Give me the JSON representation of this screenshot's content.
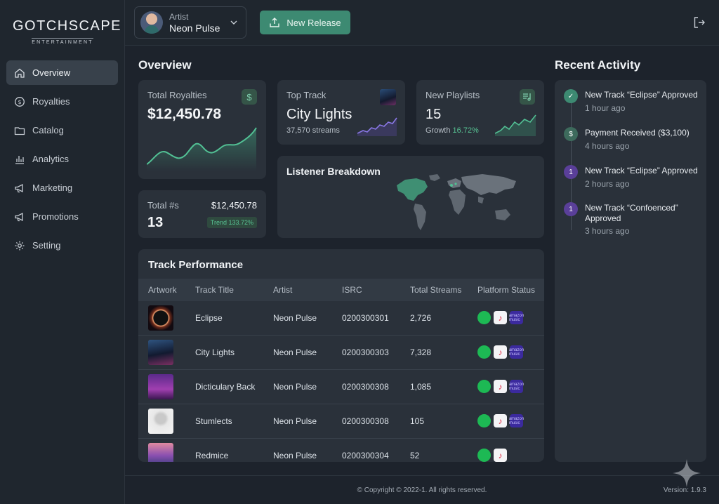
{
  "brand": {
    "name": "GOTCHSCAPE",
    "sub": "ENTERTAINMENT"
  },
  "sidebar": {
    "items": [
      {
        "label": "Overview",
        "icon": "home-icon",
        "active": true
      },
      {
        "label": "Royalties",
        "icon": "dollar-circle-icon"
      },
      {
        "label": "Catalog",
        "icon": "folder-icon"
      },
      {
        "label": "Analytics",
        "icon": "bar-chart-icon"
      },
      {
        "label": "Marketing",
        "icon": "megaphone-icon"
      },
      {
        "label": "Promotions",
        "icon": "megaphone-icon"
      },
      {
        "label": "Setting",
        "icon": "gear-icon"
      }
    ]
  },
  "topbar": {
    "artist_label": "Artist",
    "artist_name": "Neon Pulse",
    "new_release": "New Release"
  },
  "overview": {
    "title": "Overview",
    "total_royalties": {
      "label": "Total Royalties",
      "value": "$12,450.78"
    },
    "top_track": {
      "label": "Top Track",
      "value": "City Lights",
      "streams": "37,570 streams"
    },
    "new_playlists": {
      "label": "New Playlists",
      "value": "15",
      "growth_label": "Growth",
      "growth": "16.72%"
    },
    "total_count": {
      "label": "Total #s",
      "value": "13",
      "amount": "$12,450.78",
      "trend": "Trend 133.72%"
    },
    "listener": {
      "title": "Listener Breakdown"
    }
  },
  "table": {
    "title": "Track Performance",
    "headers": [
      "Artwork",
      "Track Title",
      "Artist",
      "ISRC",
      "Total Streams",
      "Platform Status"
    ],
    "rows": [
      {
        "title": "Eclipse",
        "artist": "Neon Pulse",
        "isrc": "0200300301",
        "streams": "2,726",
        "amazon": true
      },
      {
        "title": "City Lights",
        "artist": "Neon Pulse",
        "isrc": "0200300303",
        "streams": "7,328",
        "amazon": true
      },
      {
        "title": "Dicticulary Back",
        "artist": "Neon Pulse",
        "isrc": "0200300308",
        "streams": "1,085",
        "amazon": true
      },
      {
        "title": "Stumlects",
        "artist": "Neon Pulse",
        "isrc": "0200300308",
        "streams": "105",
        "amazon": true
      },
      {
        "title": "Redmice",
        "artist": "Neon Pulse",
        "isrc": "0200300304",
        "streams": "52",
        "amazon": false
      }
    ],
    "amazon_text": "amazon music"
  },
  "activity": {
    "title": "Recent Activity",
    "items": [
      {
        "text": "New Track “Eclipse” Approved",
        "time": "1 hour ago",
        "badge": "✓",
        "color": "#3d8a72"
      },
      {
        "text": "Payment Received ($3,100)",
        "time": "4 hours ago",
        "badge": "$",
        "color": "#3d6a5c"
      },
      {
        "text": "New Track “Eclipse” Approved",
        "time": "2 hours ago",
        "badge": "1",
        "color": "#5a3f99"
      },
      {
        "text": "New Track “Confoenced” Approved",
        "time": "3 hours ago",
        "badge": "1",
        "color": "#5a3f99"
      }
    ]
  },
  "footer": {
    "copyright": "© Copyright © 2022-1. All rights reserved.",
    "version": "Version: 1.9.3"
  }
}
